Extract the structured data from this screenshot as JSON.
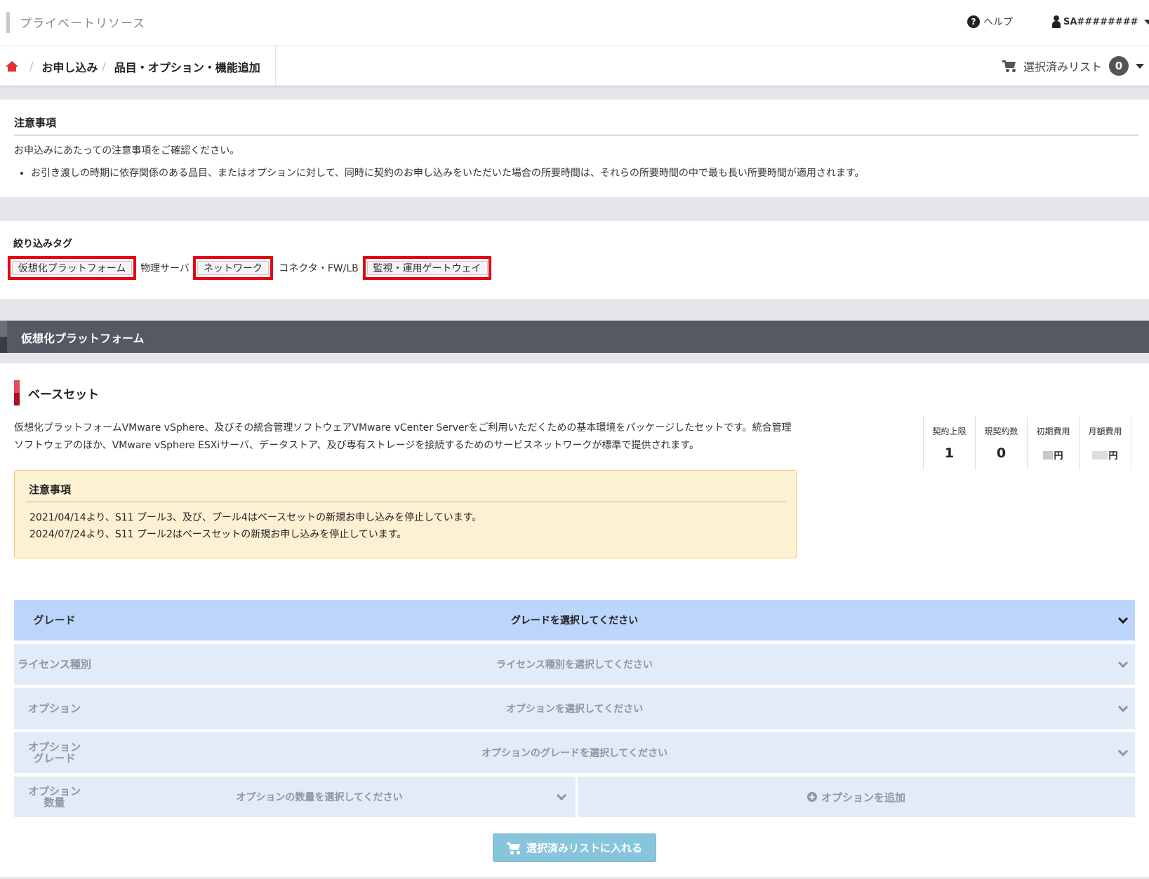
{
  "header": {
    "title": "プライベートリソース",
    "help_label": "ヘルプ",
    "user_label": "SA########"
  },
  "breadcrumb": {
    "items": [
      "お申し込み",
      "品目・オプション・機能追加"
    ]
  },
  "cart": {
    "label": "選択済みリスト",
    "count": "0"
  },
  "notice": {
    "title": "注意事項",
    "intro": "お申込みにあたっての注意事項をご確認ください。",
    "bullets": [
      "お引き渡しの時期に依存関係のある品目、またはオプションに対して、同時に契約のお申し込みをいただいた場合の所要時間は、それらの所要時間の中で最も長い所要時間が適用されます。"
    ]
  },
  "filter": {
    "title": "絞り込みタグ",
    "tags": [
      {
        "label": "仮想化プラットフォーム",
        "highlighted": true
      },
      {
        "label": "物理サーバ",
        "highlighted": false
      },
      {
        "label": "ネットワーク",
        "highlighted": true
      },
      {
        "label": "コネクタ・FW/LB",
        "highlighted": false
      },
      {
        "label": "監視・運用ゲートウェイ",
        "highlighted": true
      }
    ]
  },
  "section": {
    "title": "仮想化プラットフォーム"
  },
  "baseset": {
    "title": "ベースセット",
    "description_1": "仮想化プラットフォームVMware vSphere、及びその統合管理ソフトウェアVMware vCenter Serverをご利用いただくための基本環境をパッケージしたセットです。統合管理",
    "description_2": "ソフトウェアのほか、VMware vSphere ESXiサーバ、データストア、及び専有ストレージを接続するためのサービスネットワークが標準で提供されます。",
    "stats": {
      "limit_label": "契約上限",
      "limit_value": "1",
      "current_label": "現契約数",
      "current_value": "0",
      "initial_label": "初期費用",
      "initial_value": "円",
      "monthly_label": "月額費用",
      "monthly_value": "円"
    },
    "warning": {
      "title": "注意事項",
      "line1": "2021/04/14より、S11 プール3、及び、プール4はベースセットの新規お申し込みを停止しています。",
      "line2": "2024/07/24より、S11 プール2はベースセットの新規お申し込みを停止しています。"
    }
  },
  "selectors": {
    "grade_label": "グレード",
    "grade_placeholder": "グレードを選択してください",
    "license_label": "ライセンス種別",
    "license_placeholder": "ライセンス種別を選択してください",
    "option_label": "オプション",
    "option_placeholder": "オプションを選択してください",
    "option_grade_label_1": "オプション",
    "option_grade_label_2": "グレード",
    "option_grade_placeholder": "オプションのグレードを選択してください",
    "option_qty_label_1": "オプション",
    "option_qty_label_2": "数量",
    "option_qty_placeholder": "オプションの数量を選択してください",
    "add_option_label": "オプションを追加"
  },
  "actions": {
    "add_to_list": "選択済みリストに入れる"
  },
  "colors": {
    "highlight_border": "#e60012",
    "section_header": "#565864",
    "active_row": "#bbd5fb",
    "inactive_row": "#e2ebf8",
    "warning_bg": "#fdf1d4",
    "add_button": "#87c5dc"
  }
}
